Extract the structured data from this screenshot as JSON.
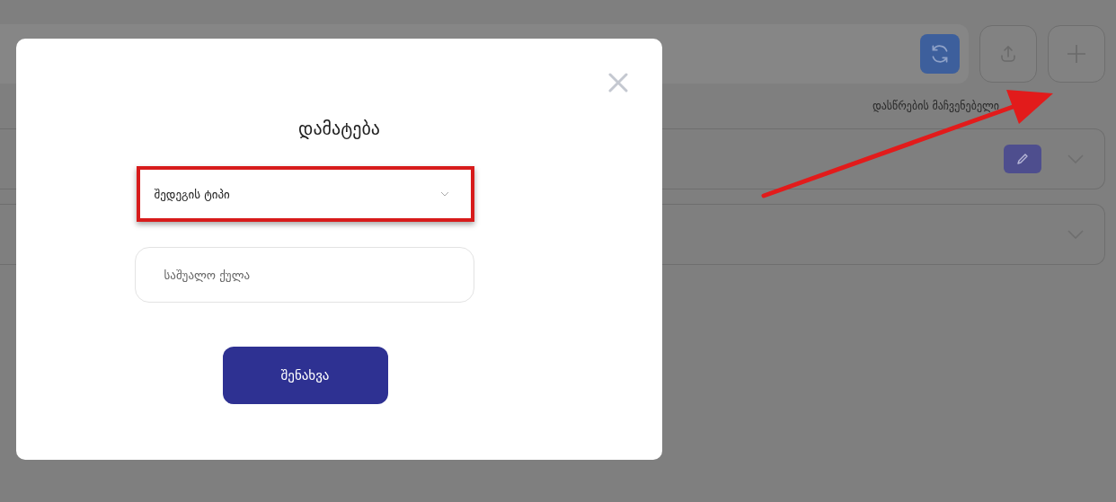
{
  "page": {
    "attendance_label": "დასწრების მაჩვენებელი",
    "rows": [
      {
        "editable": true
      },
      {
        "editable": false
      }
    ]
  },
  "modal": {
    "title": "დამატება",
    "type_select": {
      "label": "შედეგის ტიპი",
      "highlighted": true
    },
    "score_field": {
      "placeholder": "საშუალო ქულა"
    },
    "save_button": "შენახვა"
  },
  "annotation_arrow": true
}
